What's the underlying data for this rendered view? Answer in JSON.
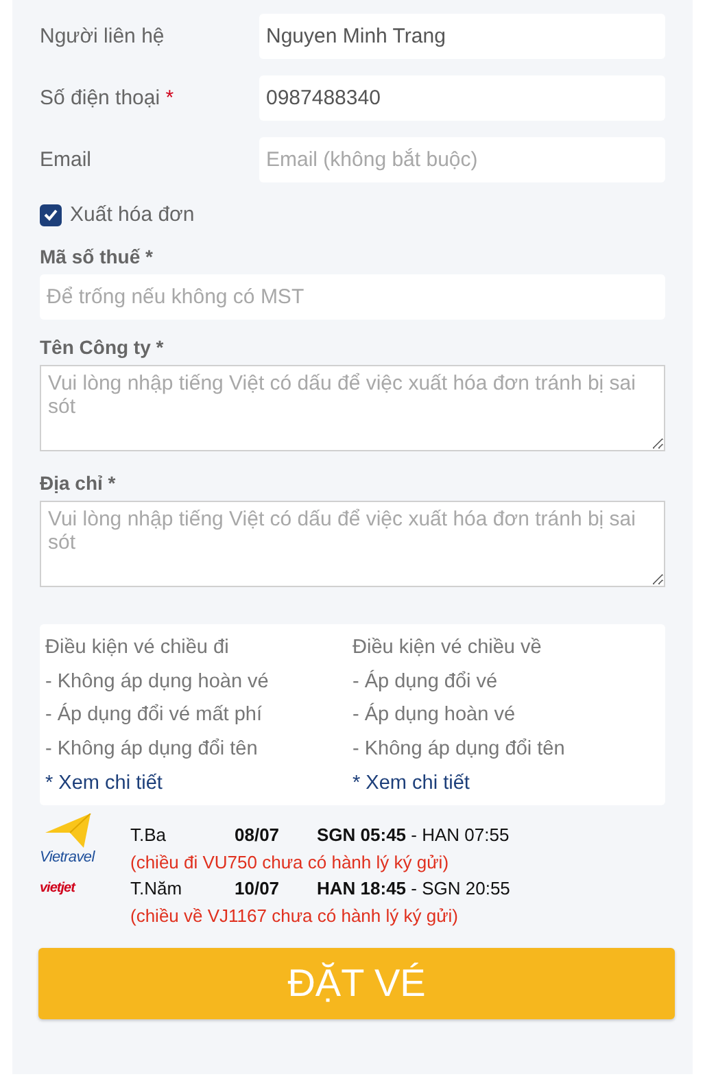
{
  "contact_fields": [
    {
      "label": "Người liên hệ",
      "value": "Nguyen Minh Trang"
    },
    {
      "label": "Số điện thoại",
      "required_mark": "*",
      "value": "0987488340"
    },
    {
      "label": "Email",
      "placeholder": "Email (không bắt buộc)"
    }
  ],
  "invoice_checkbox": {
    "label": "Xuất hóa đơn",
    "checked": true
  },
  "invoice_fields": [
    {
      "kind": "input",
      "label": "Mã số thuế *",
      "placeholder": "Để trống nếu không có MST"
    },
    {
      "kind": "textarea",
      "label": "Tên Công ty *",
      "placeholder": "Vui lòng nhập tiếng Việt có dấu để việc xuất hóa đơn tránh bị sai sót"
    },
    {
      "kind": "textarea",
      "label": "Địa chỉ *",
      "placeholder": "Vui lòng nhập tiếng Việt có dấu để việc xuất hóa đơn tránh bị sai sót"
    }
  ],
  "conditions": [
    {
      "title": "Điều kiện vé chiều đi",
      "items": [
        "- Không áp dụng hoàn vé",
        "- Áp dụng đổi vé mất phí",
        "- Không áp dụng đổi tên"
      ],
      "link": "* Xem chi tiết"
    },
    {
      "title": "Điều kiện vé chiều về",
      "items": [
        "- Áp dụng đổi vé",
        "- Áp dụng hoàn vé",
        "- Không áp dụng đổi tên"
      ],
      "link": "* Xem chi tiết"
    }
  ],
  "flights": [
    {
      "kind": "vietravel",
      "logo_text": "Vietravel",
      "day": "T.Ba",
      "date": "08/07",
      "route": "**SGN 05:45** - HAN 07:55",
      "note": "(chiều đi VU750 chưa có hành lý ký gửi)"
    },
    {
      "kind": "vietjet",
      "logo_text": "vietjet",
      "day": "T.Năm",
      "date": "10/07",
      "route": "**HAN 18:45** - SGN 20:55",
      "note": "(chiều về VJ1167 chưa có hành lý ký gửi)"
    }
  ],
  "submit_button": "ĐẶT VÉ"
}
